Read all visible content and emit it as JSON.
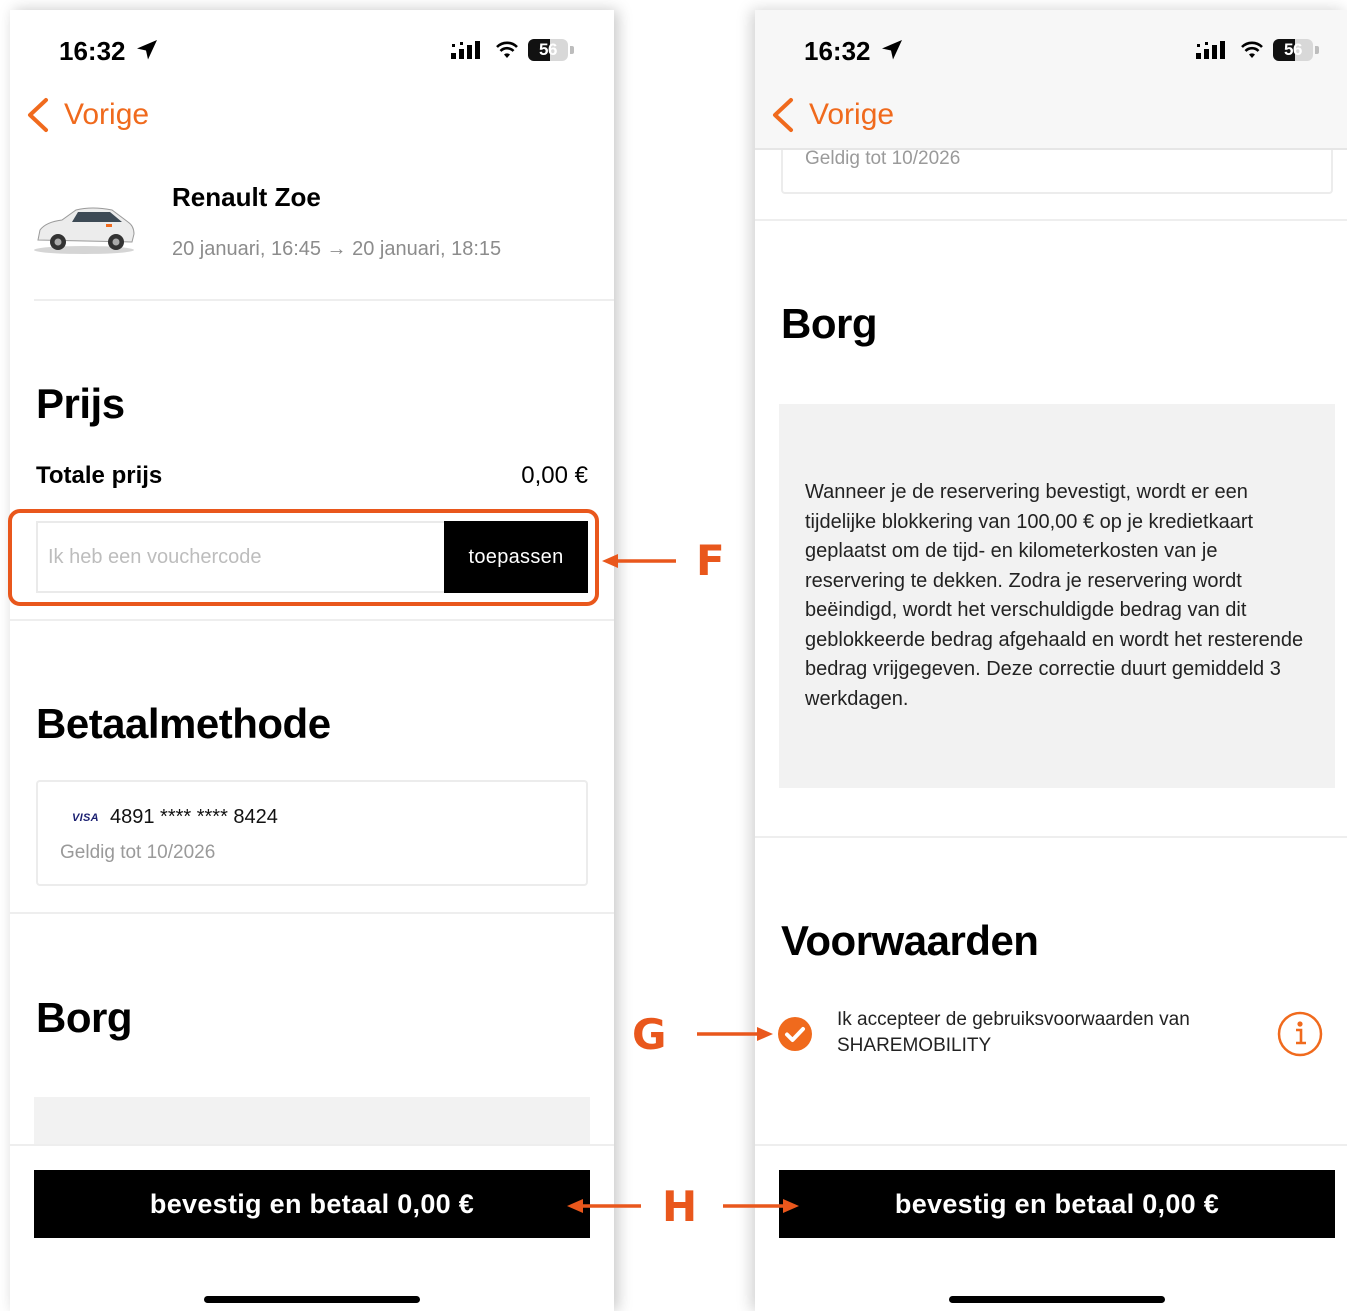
{
  "status_bar": {
    "time": "16:32",
    "battery": "56",
    "battery_level_percent": 56
  },
  "nav": {
    "back_label": "Vorige"
  },
  "booking": {
    "car_name": "Renault Zoe",
    "dates": "20 januari, 16:45 → 20 januari, 18:15"
  },
  "price": {
    "heading": "Prijs",
    "total_label": "Totale prijs",
    "total_value": "0,00 €"
  },
  "voucher": {
    "placeholder": "Ik heb een vouchercode",
    "apply_label": "toepassen"
  },
  "payment": {
    "heading": "Betaalmethode",
    "card_brand": "VISA",
    "card_number": "4891 **** **** 8424",
    "valid_until": "Geldig tot 10/2026"
  },
  "deposit": {
    "heading": "Borg",
    "text": "Wanneer je de reservering bevestigt, wordt er een tijdelijke blokkering van 100,00 € op je kredietkaart geplaatst om de tijd- en kilometerkosten van je reservering te dekken. Zodra je reservering wordt beëindigd, wordt het verschuldigde bedrag van dit geblokkeerde bedrag afgehaald en wordt het resterende bedrag vrijgegeven. Deze correctie duurt gemiddeld 3 werkdagen."
  },
  "terms": {
    "heading": "Voorwaarden",
    "accept_text": "Ik accepteer de gebruiksvoorwaarden van SHAREMOBILITY",
    "accepted": true
  },
  "cta": {
    "confirm_label": "bevestig en betaal 0,00 €"
  },
  "callouts": {
    "f": "F",
    "g": "G",
    "h": "H"
  },
  "colors": {
    "accent": "#f06a1d",
    "callout": "#e9571c",
    "button": "#000000",
    "grey_box": "#f2f2f2"
  },
  "icons": [
    "location-arrow-icon",
    "signal-icon",
    "wifi-icon",
    "battery-icon",
    "chevron-left-icon",
    "car-image",
    "visa-icon",
    "check-circle-icon",
    "info-icon"
  ]
}
